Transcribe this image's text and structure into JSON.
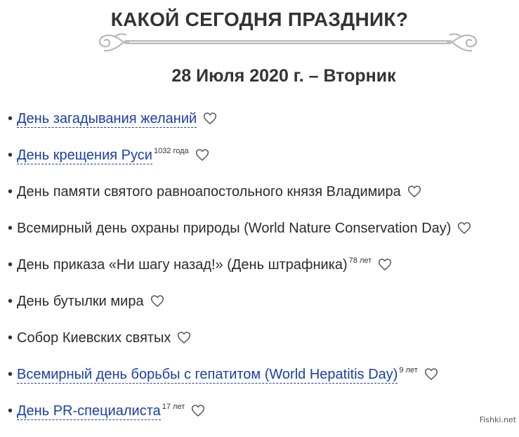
{
  "header": {
    "title": "КАКОЙ СЕГОДНЯ ПРАЗДНИК?",
    "date": "28 Июля 2020 г. – Вторник"
  },
  "colors": {
    "link": "#1a3fa8",
    "text": "#2b2b2b",
    "ornament": "#b3b3b3"
  },
  "holidays": [
    {
      "name": "День загадывания желаний",
      "link": true,
      "years": ""
    },
    {
      "name": "День крещения Руси",
      "link": true,
      "years": "1032 года"
    },
    {
      "name": "День памяти святого равноапостольного князя Владимира",
      "link": false,
      "years": ""
    },
    {
      "name": "Всемирный день охраны природы (World Nature Conservation Day)",
      "link": false,
      "years": ""
    },
    {
      "name": "День приказа «Ни шагу назад!» (День штрафника)",
      "link": false,
      "years": "78 лет"
    },
    {
      "name": "День бутылки мира",
      "link": false,
      "years": ""
    },
    {
      "name": "Собор Киевских святых",
      "link": false,
      "years": ""
    },
    {
      "name": "Всемирный день борьбы с гепатитом (World Hepatitis Day)",
      "link": true,
      "years": "9 лет"
    },
    {
      "name": "День PR-специалиста",
      "link": true,
      "years": "17 лет"
    }
  ],
  "bullet": "•",
  "icons": {
    "favorite": "heart-outline-icon",
    "ornament": "ornamental-divider"
  },
  "watermark": "Fishki.net"
}
